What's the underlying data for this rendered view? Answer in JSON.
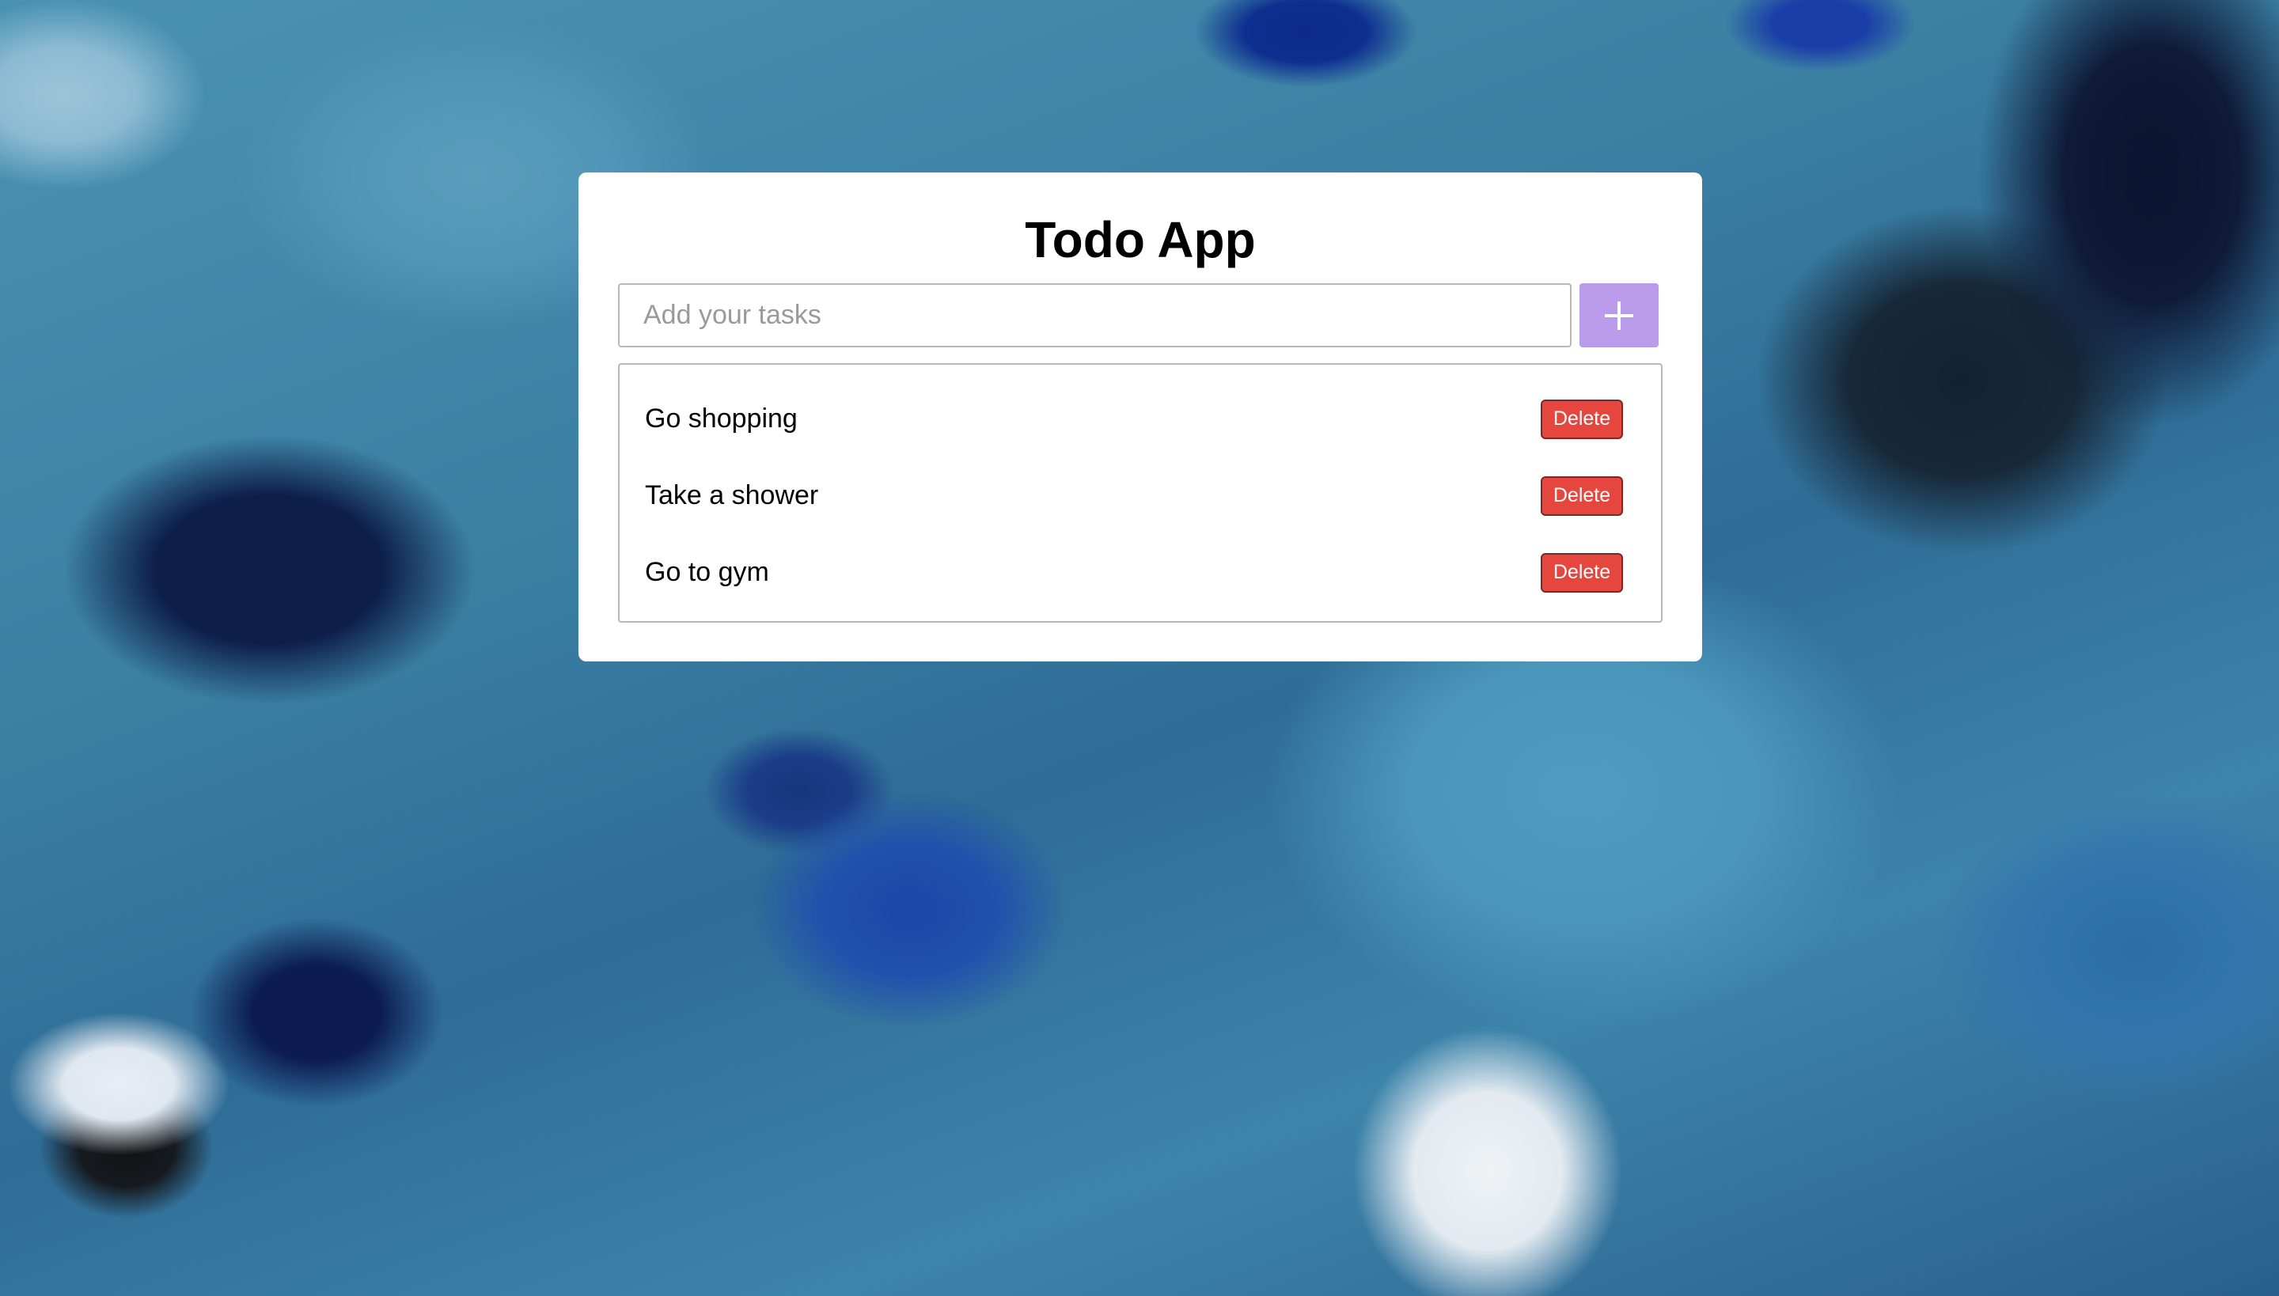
{
  "app": {
    "title": "Todo App"
  },
  "input": {
    "placeholder": "Add your tasks",
    "value": ""
  },
  "add_button": {
    "icon": "plus-icon",
    "color": "#b99bea"
  },
  "tasks": [
    {
      "text": "Go shopping",
      "delete_label": "Delete"
    },
    {
      "text": "Take a shower",
      "delete_label": "Delete"
    },
    {
      "text": "Go to gym",
      "delete_label": "Delete"
    }
  ],
  "colors": {
    "delete": "#e5473e",
    "card": "#ffffff"
  }
}
